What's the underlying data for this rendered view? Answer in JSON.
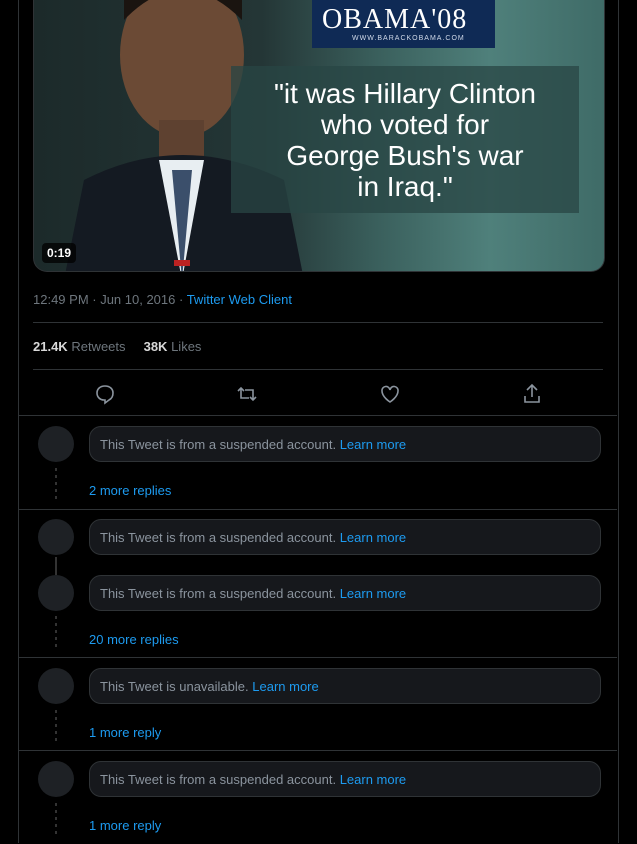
{
  "media": {
    "logo_main": "OBAMA'08",
    "logo_sub": "WWW.BARACKOBAMA.COM",
    "quote_lines": [
      "\"it was Hillary Clinton",
      "who voted for",
      "George Bush's war",
      "in Iraq.\""
    ],
    "duration": "0:19"
  },
  "tweet_meta": {
    "time_date": "12:49 PM · Jun 10, 2016 · ",
    "client": "Twitter Web Client"
  },
  "stats": {
    "retweets_count": "21.4K",
    "retweets_label": "Retweets",
    "likes_count": "38K",
    "likes_label": "Likes"
  },
  "actions": [
    "reply-icon",
    "retweet-icon",
    "like-icon",
    "share-icon"
  ],
  "threads": [
    {
      "replies": [
        {
          "text": "This Tweet is from a suspended account.",
          "link": "Learn more"
        }
      ],
      "more": "2 more replies"
    },
    {
      "replies": [
        {
          "text": "This Tweet is from a suspended account.",
          "link": "Learn more"
        },
        {
          "text": "This Tweet is from a suspended account.",
          "link": "Learn more"
        }
      ],
      "more": "20 more replies"
    },
    {
      "replies": [
        {
          "text": "This Tweet is unavailable.",
          "link": "Learn more"
        }
      ],
      "more": "1 more reply"
    },
    {
      "replies": [
        {
          "text": "This Tweet is from a suspended account.",
          "link": "Learn more"
        }
      ],
      "more": "1 more reply"
    }
  ],
  "colors": {
    "accent": "#1d9bf0",
    "background": "#000000",
    "border": "#2f3336"
  }
}
